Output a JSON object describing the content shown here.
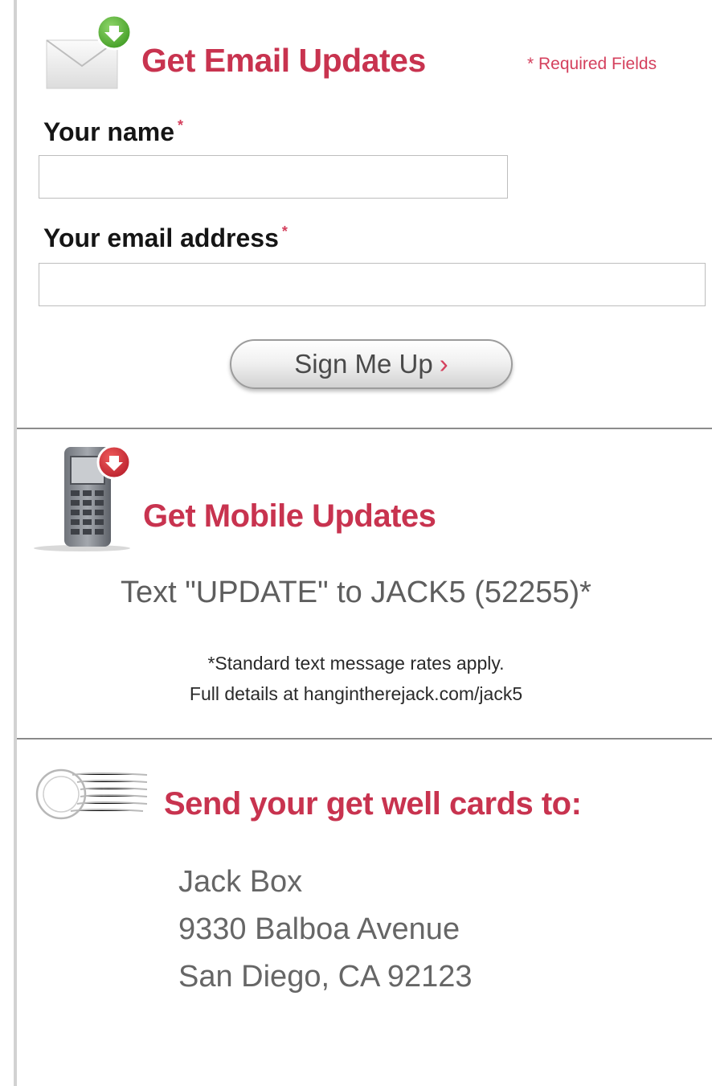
{
  "email_section": {
    "heading": "Get Email Updates",
    "required_note": "* Required Fields",
    "name_label": "Your name",
    "email_label": "Your email address",
    "required_star": "*",
    "name_value": "",
    "email_value": "",
    "submit_label": "Sign Me Up",
    "submit_chevron": "›",
    "icon": "envelope-add-icon"
  },
  "mobile_section": {
    "heading": "Get Mobile Updates",
    "text_line": "Text \"UPDATE\" to JACK5 (52255)*",
    "note_line1": "*Standard text message rates apply.",
    "note_line2": "Full details at hangintherejack.com/jack5",
    "icon": "mobile-phone-icon"
  },
  "mail_section": {
    "heading": "Send your get well cards to:",
    "address": [
      "Jack Box",
      "9330 Balboa Avenue",
      "San Diego, CA 92123"
    ],
    "icon": "postmark-icon"
  },
  "colors": {
    "accent": "#c8334f",
    "badge_green": "#4caa2e",
    "badge_red": "#cc2a38"
  }
}
